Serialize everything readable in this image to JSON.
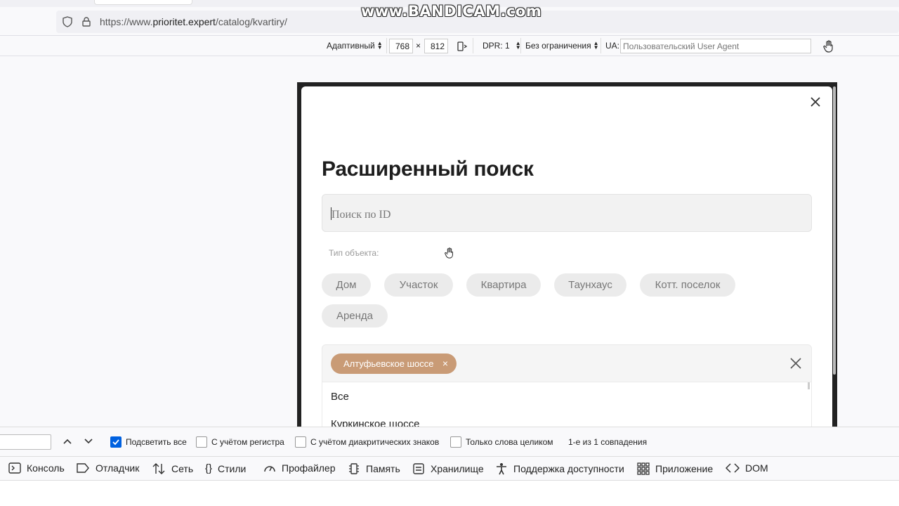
{
  "browser": {
    "url_prefix": "https://www.",
    "url_domain": "prioritet.expert",
    "url_path": "/catalog/kvartiry/",
    "watermark": "www.BANDICAM.com"
  },
  "responsive_toolbar": {
    "mode": "Адаптивный",
    "width": "768",
    "times": "×",
    "height": "812",
    "dpr": "DPR: 1",
    "throttle": "Без ограничения",
    "ua_label": "UA:",
    "ua_placeholder": "Пользовательский User Agent"
  },
  "modal": {
    "title": "Расширенный поиск",
    "search_placeholder": "Поиск по ID",
    "type_label": "Тип объекта:",
    "types": [
      "Дом",
      "Участок",
      "Квартира",
      "Таунхаус",
      "Котт. поселок",
      "Аренда"
    ],
    "selected_tag": "Алтуфьевское шоссе",
    "tag_remove": "×",
    "options": [
      "Все",
      "Куркинское шоссе"
    ]
  },
  "findbar": {
    "highlight_all": "Подсветить все",
    "match_case": "С учётом регистра",
    "match_diacritics": "С учётом диакритических знаков",
    "whole_words": "Только слова целиком",
    "result": "1-е из 1 совпадения"
  },
  "devtools_tabs": [
    "Консоль",
    "Отладчик",
    "Сеть",
    "Стили",
    "Профайлер",
    "Память",
    "Хранилище",
    "Поддержка доступности",
    "Приложение",
    "DOM"
  ]
}
